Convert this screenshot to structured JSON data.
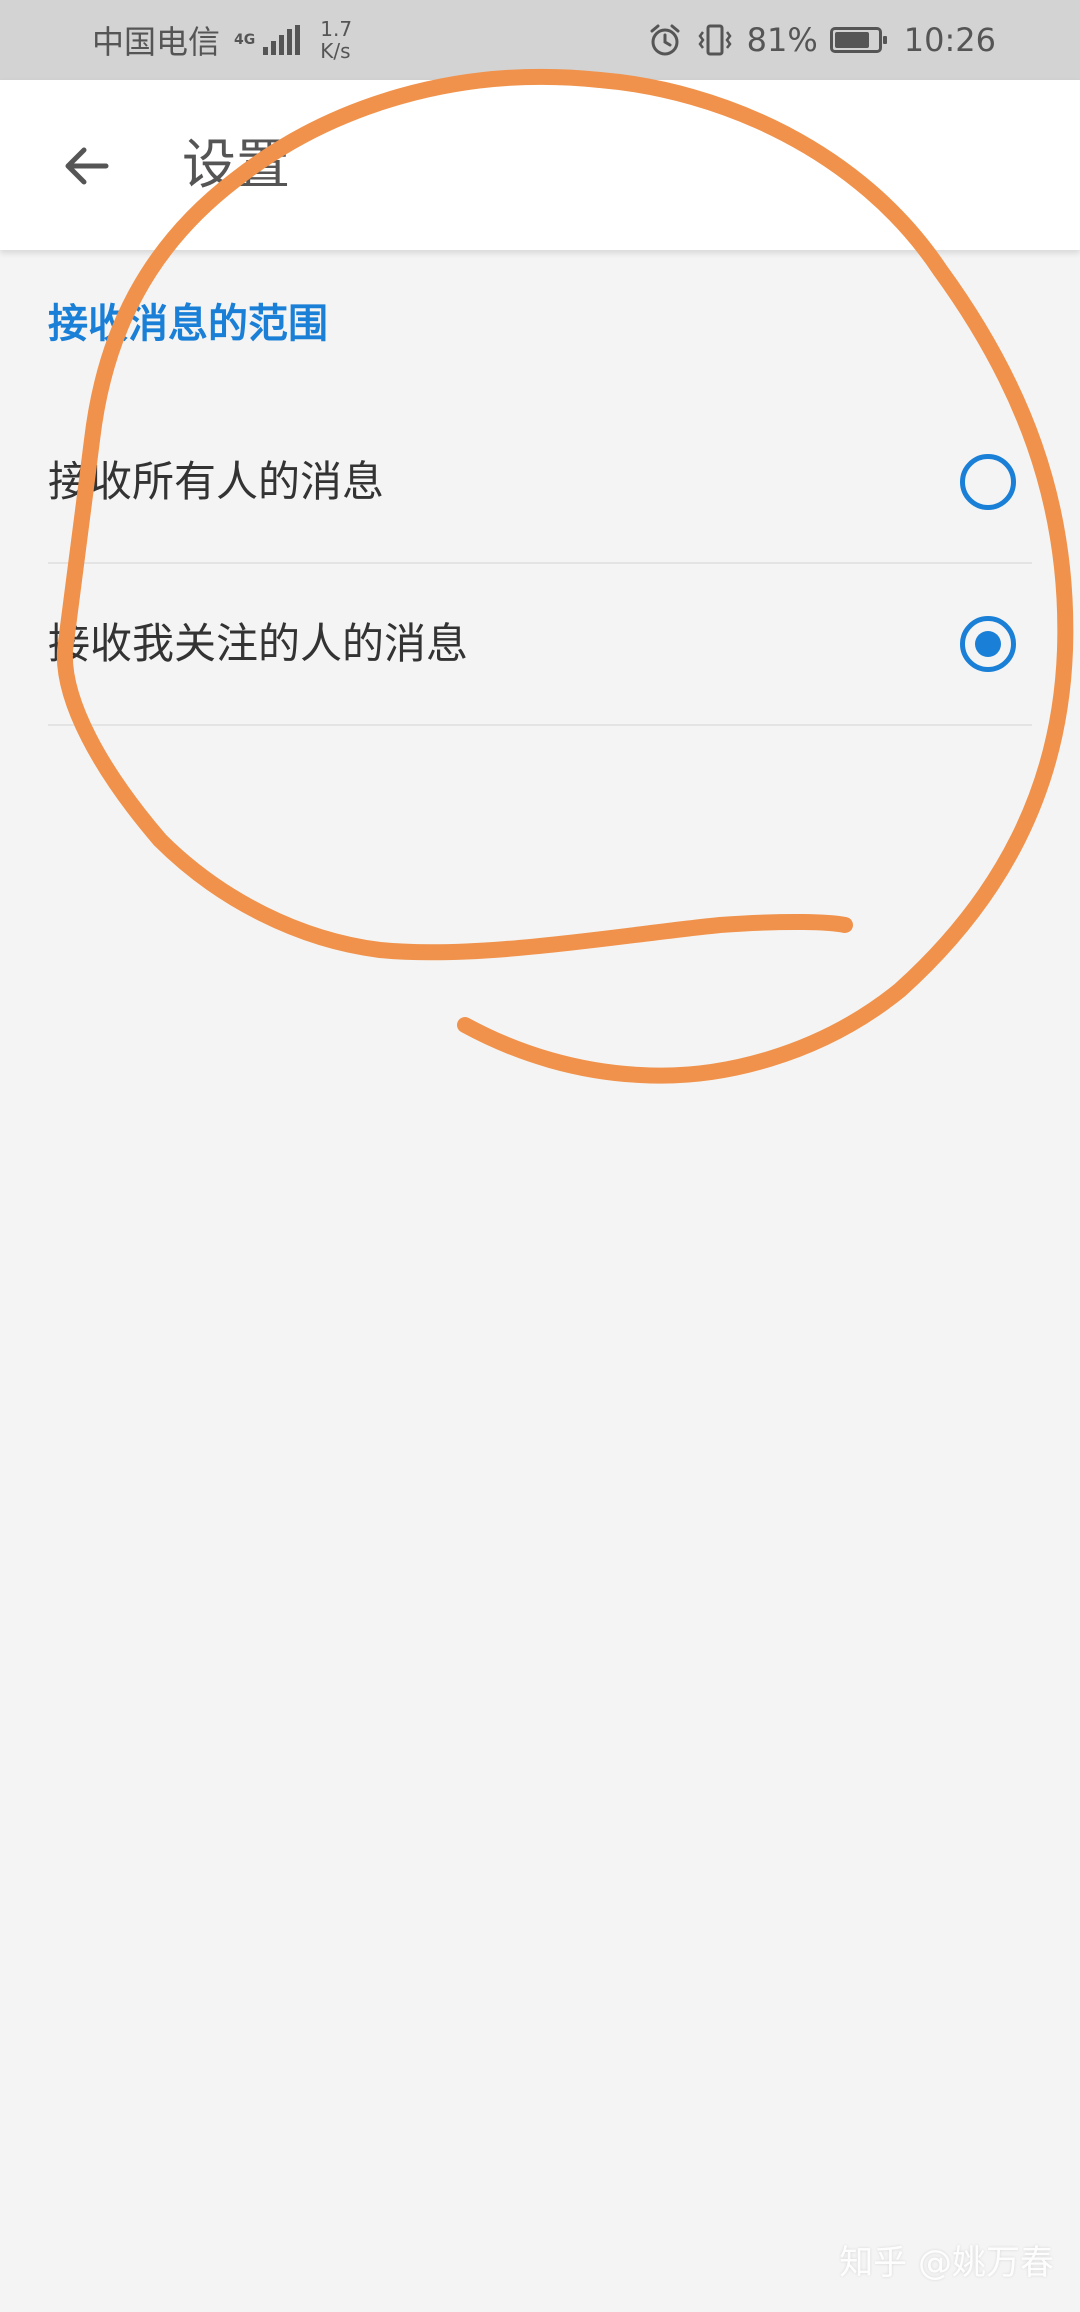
{
  "status_bar": {
    "carrier": "中国电信",
    "network_type": "4G",
    "speed_value": "1.7",
    "speed_unit": "K/s",
    "battery_percent": "81%",
    "battery_level": 0.81,
    "time": "10:26",
    "icons": [
      "signal-icon",
      "alarm-icon",
      "vibrate-icon",
      "battery-icon"
    ]
  },
  "app_bar": {
    "title": "设置",
    "back_icon": "arrow-left-icon"
  },
  "section": {
    "header": "接收消息的范围",
    "options": [
      {
        "label": "接收所有人的消息",
        "selected": false
      },
      {
        "label": "接收我关注的人的消息",
        "selected": true
      }
    ]
  },
  "watermark": "知乎 @姚万春",
  "colors": {
    "accent": "#1a7fd6",
    "annotation": "#f0924b",
    "status_bar_bg": "#d3d3d3",
    "page_bg": "#f4f4f4"
  }
}
